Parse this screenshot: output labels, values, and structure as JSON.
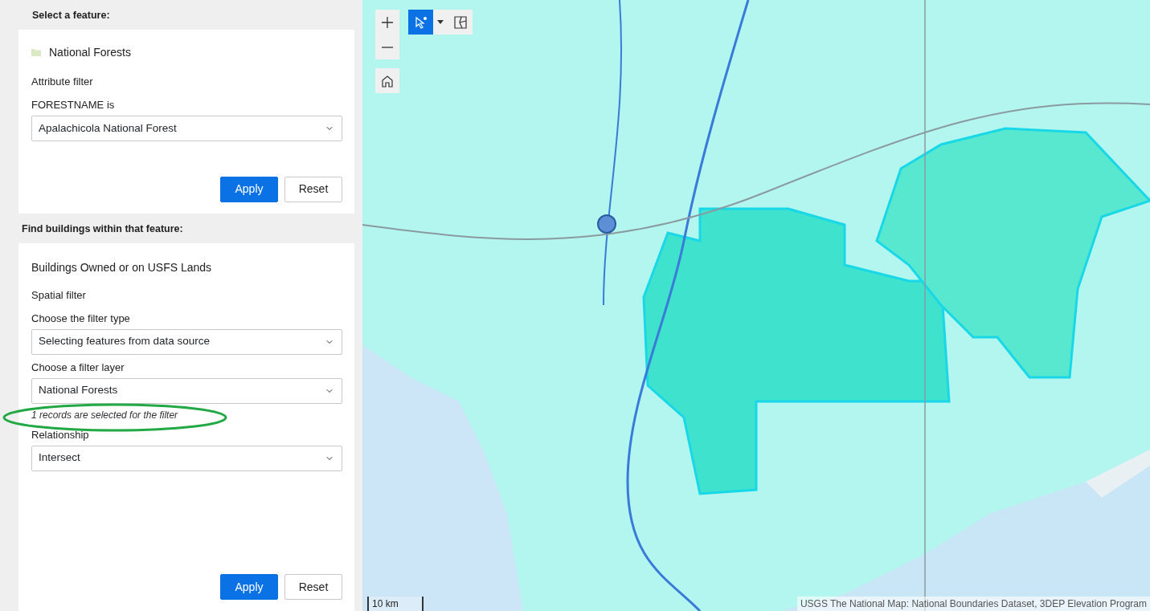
{
  "panel": {
    "sections": [
      {
        "heading": "Select a feature:",
        "layer_name": "National Forests",
        "filter_title": "Attribute filter",
        "fields": [
          {
            "label": "FORESTNAME is",
            "value": "Apalachicola National Forest"
          }
        ],
        "buttons": [
          {
            "label": "Apply",
            "kind": "primary"
          },
          {
            "label": "Reset",
            "kind": "secondary"
          }
        ]
      },
      {
        "heading": "Find buildings within that feature:",
        "title": "Buildings Owned or on USFS Lands",
        "filter_title": "Spatial filter",
        "fields": [
          {
            "label": "Choose the filter type",
            "value": "Selecting features from data source"
          },
          {
            "label": "Choose a filter layer",
            "value": "National Forests",
            "note": "1 records are selected for the filter",
            "highlighted": true
          },
          {
            "label": "Relationship",
            "value": "Intersect"
          }
        ],
        "buttons": [
          {
            "label": "Apply",
            "kind": "primary"
          },
          {
            "label": "Reset",
            "kind": "secondary"
          }
        ]
      }
    ]
  },
  "map": {
    "kind": "picture",
    "zoom_tools": [
      {
        "kind": "zoom-in"
      },
      {
        "kind": "zoom-out"
      }
    ],
    "home_tool": {
      "kind": "home"
    },
    "select_tools": [
      {
        "kind": "pointer",
        "selected": true
      },
      {
        "kind": "caret",
        "selected": false
      },
      {
        "kind": "lasso",
        "selected": false
      }
    ],
    "scale_bar": "10 km",
    "attribution": "USGS The National Map: National Boundaries Dataset, 3DEP Elevation Program"
  }
}
